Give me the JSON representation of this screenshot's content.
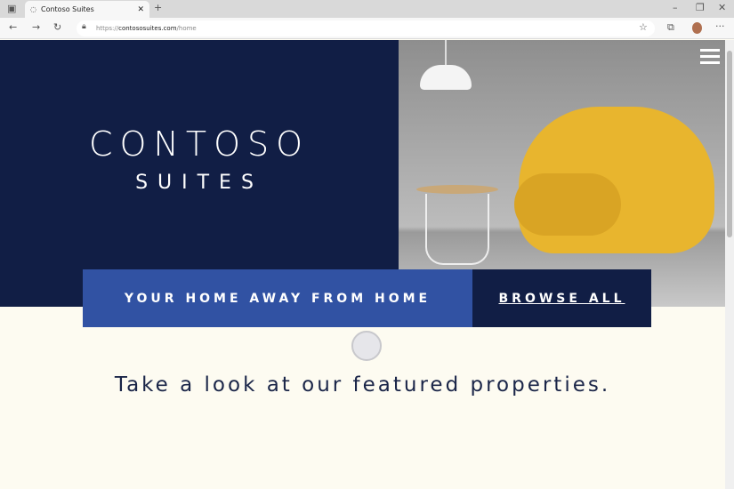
{
  "browser": {
    "tab_title": "Contoso Suites",
    "url_prefix": "https://",
    "url_domain": "contososuites.com",
    "url_path": "/home"
  },
  "hero": {
    "logo_line1": "CONTOSO",
    "logo_line2": "SUITES"
  },
  "banner": {
    "tagline": "YOUR HOME AWAY FROM HOME",
    "browse_label": "BROWSE ALL"
  },
  "main": {
    "heading": "Take a look at our featured properties."
  },
  "colors": {
    "navy": "#111e45",
    "blue": "#3152a3",
    "cream": "#fdfbf1",
    "chair": "#e8b52e"
  }
}
